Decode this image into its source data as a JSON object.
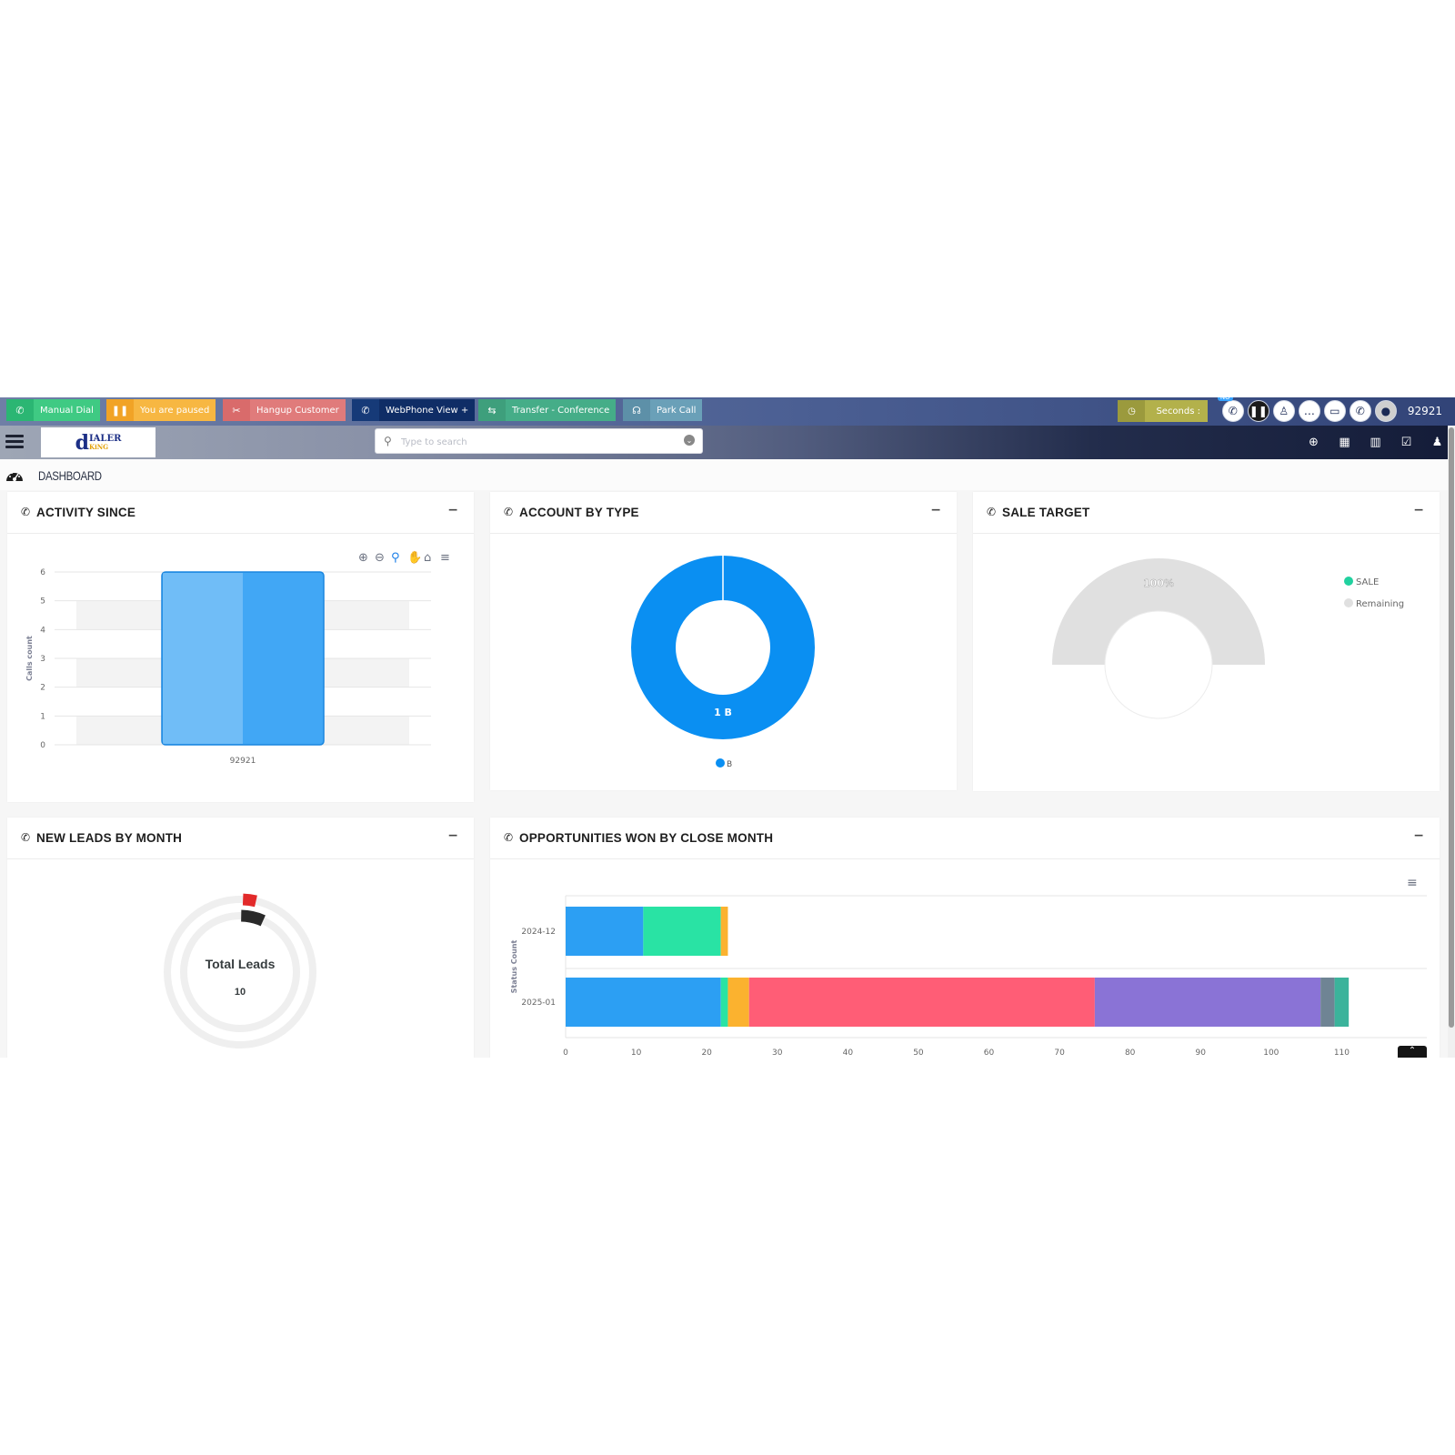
{
  "callbar": {
    "buttons": [
      {
        "label": "Manual Dial",
        "icon": "phone-dial-icon"
      },
      {
        "label": "You are paused",
        "icon": "pause-icon"
      },
      {
        "label": "Hangup Customer",
        "icon": "hangup-icon"
      },
      {
        "label": "WebPhone View +",
        "icon": "phone-icon"
      },
      {
        "label": "Transfer - Conference",
        "icon": "transfer-icon"
      },
      {
        "label": "Park Call",
        "icon": "park-icon"
      }
    ],
    "seconds_label": "Seconds :",
    "badge": "NO",
    "user_id": "92921"
  },
  "navbar": {
    "logo_main": "IALER",
    "logo_sub": "KiNG",
    "search_placeholder": "Type to search"
  },
  "breadcrumb": {
    "title": "DASHBOARD"
  },
  "panels": {
    "activity": {
      "title": "ACTIVITY SINCE"
    },
    "account": {
      "title": "ACCOUNT BY TYPE"
    },
    "sale": {
      "title": "SALE TARGET"
    },
    "leads": {
      "title": "NEW LEADS BY MONTH"
    },
    "opps": {
      "title": "OPPORTUNITIES WON BY CLOSE MONTH"
    }
  },
  "chart_data": [
    {
      "id": "activity",
      "type": "bar",
      "categories": [
        "92921"
      ],
      "values": [
        6
      ],
      "xlabel": "",
      "ylabel": "Calls count",
      "ylim": [
        0,
        6
      ],
      "yticks": [
        0,
        1,
        2,
        3,
        4,
        5,
        6
      ],
      "color": "#41a7f5"
    },
    {
      "id": "account",
      "type": "pie",
      "labels": [
        "B"
      ],
      "values": [
        1
      ],
      "slice_labels": [
        "1 B"
      ],
      "legend": [
        "B"
      ],
      "colors": [
        "#0a8ff2"
      ]
    },
    {
      "id": "sale",
      "type": "pie",
      "labels": [
        "SALE",
        "Remaining"
      ],
      "values": [
        0,
        100
      ],
      "center_label": "100%",
      "legend": [
        "SALE",
        "Remaining"
      ],
      "colors": [
        "#21d19f",
        "#e0e0e0"
      ]
    },
    {
      "id": "leads",
      "type": "pie",
      "center_title": "Total Leads",
      "center_value": "10",
      "colors": [
        "#e22a2a",
        "#2a2a2a",
        "#efefef"
      ]
    },
    {
      "id": "opps",
      "type": "bar",
      "orientation": "horizontal",
      "stacked": true,
      "categories": [
        "2024-12",
        "2025-01"
      ],
      "ylabel": "Status Count",
      "xlim": [
        0,
        120
      ],
      "xticks": [
        0,
        10,
        20,
        30,
        40,
        50,
        60,
        70,
        80,
        90,
        100,
        110
      ],
      "series": [
        {
          "values": [
            11,
            22
          ],
          "color": "#2c9ff3"
        },
        {
          "values": [
            11,
            1
          ],
          "color": "#29e3a4"
        },
        {
          "values": [
            1,
            3
          ],
          "color": "#fbb22f"
        },
        {
          "values": [
            0,
            49
          ],
          "color": "#ff5d76"
        },
        {
          "values": [
            0,
            32
          ],
          "color": "#8a73d6"
        },
        {
          "values": [
            0,
            2
          ],
          "color": "#6f8494"
        },
        {
          "values": [
            0,
            2
          ],
          "color": "#3bb39b"
        }
      ]
    }
  ]
}
